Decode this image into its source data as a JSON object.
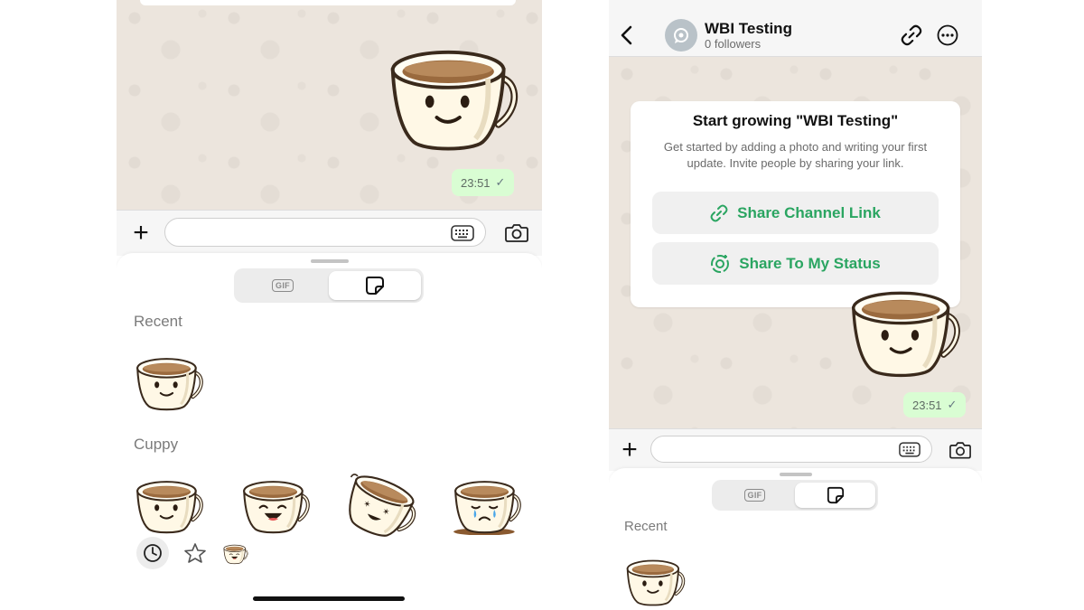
{
  "colors": {
    "accent_green": "#2aa561",
    "bubble_green": "#d9fdd3",
    "chat_bg": "#ece5dd"
  },
  "left": {
    "message_time": "23:51",
    "picker": {
      "tabs": [
        {
          "label": "GIF",
          "icon": "gif-icon",
          "selected": false
        },
        {
          "label": "",
          "icon": "sticker-icon",
          "selected": true
        }
      ],
      "section_recent": "Recent",
      "section_pack": "Cuppy",
      "bottom_icons": [
        "clock-icon",
        "star-icon",
        "cuppy-pack-icon"
      ]
    }
  },
  "right": {
    "header": {
      "channel_name": "WBI Testing",
      "followers": "0 followers",
      "icons": [
        "back-icon",
        "channel-avatar-icon",
        "link-icon",
        "more-icon"
      ]
    },
    "card": {
      "title": "Start growing \"WBI Testing\"",
      "text": "Get started by adding a photo and writing your first update. Invite people by sharing your link.",
      "buttons": [
        {
          "label": "Share Channel Link",
          "icon": "link-icon"
        },
        {
          "label": "Share To My Status",
          "icon": "status-icon"
        }
      ]
    },
    "message_time": "23:51",
    "picker": {
      "tabs": [
        {
          "label": "GIF",
          "icon": "gif-icon",
          "selected": false
        },
        {
          "label": "",
          "icon": "sticker-icon",
          "selected": true
        }
      ],
      "section_recent": "Recent"
    }
  }
}
